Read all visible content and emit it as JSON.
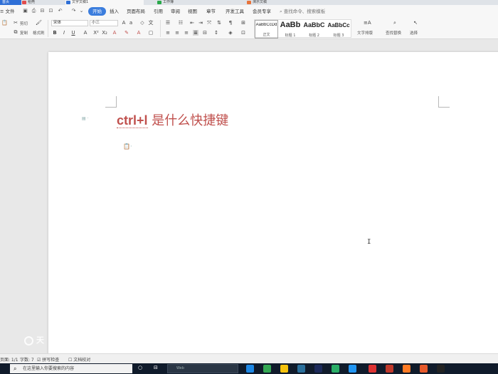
{
  "tabbar": {
    "home_label": "首页",
    "tabs": [
      {
        "label": "稻壳",
        "color": "#e04d4d"
      },
      {
        "label": "文字文稿1",
        "color": "#2f6fd6"
      },
      {
        "label": "工作簿",
        "color": "#2aa84a"
      },
      {
        "label": "演示文稿",
        "color": "#e8733a"
      }
    ]
  },
  "menubar": {
    "file_label": "文件",
    "tabs": [
      "开始",
      "插入",
      "页面布局",
      "引用",
      "审阅",
      "视图",
      "章节",
      "开发工具",
      "会员专享"
    ],
    "search_placeholder": "查找命令、搜索模板"
  },
  "ribbon": {
    "cut_label": "剪切",
    "copy_label": "复制",
    "format_painter_label": "格式刷",
    "font_name": "宋体",
    "font_size": "小三",
    "styles": [
      {
        "sample": "AaBbCcDd",
        "label": "正文"
      },
      {
        "sample": "AaBb",
        "label": "标题 1"
      },
      {
        "sample": "AaBbC",
        "label": "标题 2"
      },
      {
        "sample": "AaBbCc",
        "label": "标题 3"
      }
    ],
    "text_layout_label": "文字排版",
    "find_replace_label": "查找替换",
    "select_label": "选择"
  },
  "document": {
    "heading_en": "ctrl+l",
    "heading_zh": " 是什么快捷键"
  },
  "statusbar": {
    "page": "页面: 1/1",
    "words": "字数: 7",
    "spell_check": "拼写检查",
    "doc_proof": "文档校对"
  },
  "watermark": "天",
  "taskbar": {
    "search_placeholder": "在这里输入你要搜索的内容",
    "app_search_placeholder": "Web"
  },
  "colors": {
    "accent": "#3b7ddd",
    "heading": "#c0504d",
    "taskbar": "#101b2b"
  }
}
